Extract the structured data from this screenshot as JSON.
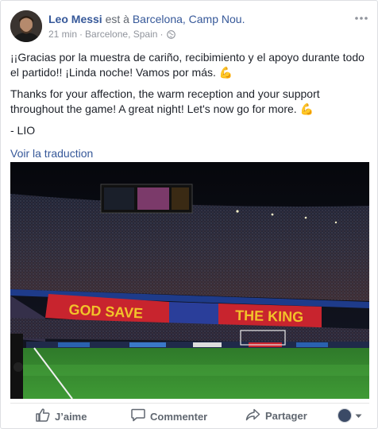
{
  "post": {
    "author": "Leo Messi",
    "verb": "est à",
    "place": "Barcelona, Camp Nou.",
    "time": "21 min",
    "location": "Barcelone, Spain",
    "paragraphs": [
      "¡¡Gracias por la muestra de cariño, recibimiento y el apoyo durante todo el partido!! ¡Linda noche! Vamos por más.",
      "Thanks for your affection, the warm reception and your support throughout the game! A great night! Let's now go for more.",
      "- LIO"
    ],
    "see_translation": "Voir la traduction",
    "photo": {
      "tifo_left": "GOD SAVE",
      "tifo_right": "THE KING"
    }
  },
  "actions": {
    "like": "J’aime",
    "comment": "Commenter",
    "share": "Partager"
  },
  "icons": {
    "more": "more-options-icon",
    "privacy": "globe-icon",
    "emoji": "flexed-biceps-emoji"
  },
  "colors": {
    "link": "#365899",
    "text": "#1d2129",
    "meta": "#90949c",
    "action": "#606770"
  }
}
